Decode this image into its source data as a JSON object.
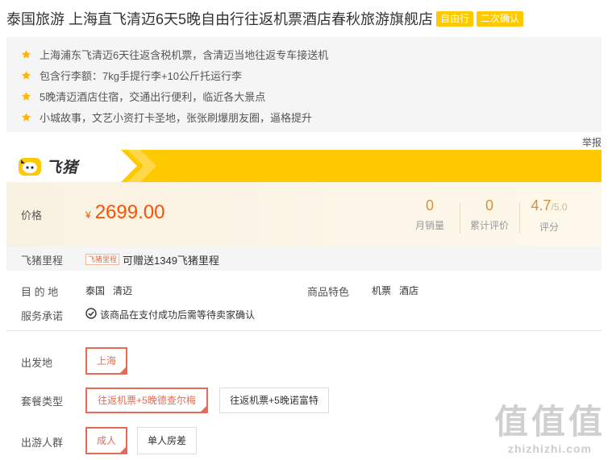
{
  "product": {
    "title": "泰国旅游 上海直飞清迈6天5晚自由行往返机票酒店春秋旅游旗舰店",
    "tags": [
      "自由行",
      "二次确认"
    ]
  },
  "features": [
    "上海浦东飞清迈6天往返含税机票，含清迈当地往返专车接送机",
    "包含行李额：7kg手提行李+10公斤托运行李",
    "5晚清迈酒店住宿，交通出行便利，临近各大景点",
    "小城故事，文艺小资打卡圣地，张张刷爆朋友圈，逼格提升"
  ],
  "report_link": "举报",
  "brand": {
    "name": "飞猪",
    "color": "#ffc900"
  },
  "price": {
    "label": "价格",
    "currency": "¥",
    "value": "2699.00",
    "color": "#ff5000"
  },
  "stats": [
    {
      "value": "0",
      "suffix": "",
      "label": "月销量"
    },
    {
      "value": "0",
      "suffix": "",
      "label": "累计评价"
    },
    {
      "value": "4.7",
      "suffix": "/5.0",
      "label": "评分"
    }
  ],
  "miles": {
    "label": "飞猪里程",
    "badge": "飞猪里程",
    "text": "可赠送1349飞猪里程"
  },
  "info": {
    "destination_label": "目 的 地",
    "destination_value": "泰国   清迈",
    "feature_label": "商品特色",
    "feature_value": "机票   酒店",
    "service_label": "服务承诺",
    "service_value": "该商品在支付成功后需等待卖家确认"
  },
  "options": {
    "departure": {
      "label": "出发地",
      "items": [
        "上海"
      ],
      "selected": 0
    },
    "package": {
      "label": "套餐类型",
      "items": [
        "往返机票+5晚德查尔梅",
        "往返机票+5晚诺富特"
      ],
      "selected": 0
    },
    "group": {
      "label": "出游人群",
      "items": [
        "成人",
        "单人房差"
      ],
      "selected": 0
    }
  },
  "watermark": {
    "big": "值值值",
    "small": "zhizhizhi.com"
  },
  "colors": {
    "accent": "#e46b55",
    "star": "#ffb400",
    "stat_number": "#d8903b"
  }
}
